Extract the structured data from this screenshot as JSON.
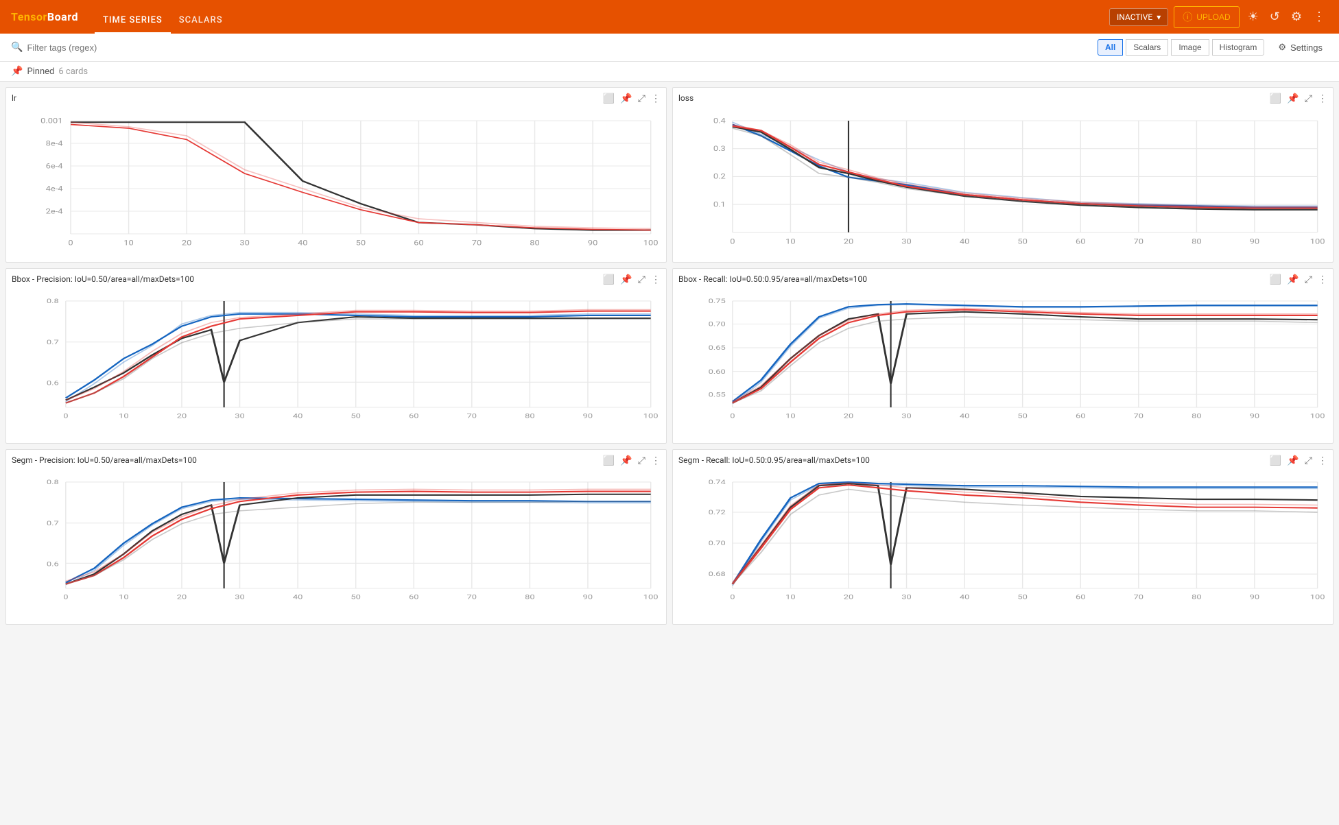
{
  "header": {
    "logo_tensor": "Tensor",
    "logo_board": "Board",
    "nav_items": [
      "TIME SERIES",
      "SCALARS"
    ],
    "active_nav": "TIME SERIES",
    "inactive_label": "INACTIVE",
    "upload_label": "UPLOAD",
    "status_color": "#FFB300"
  },
  "search": {
    "placeholder": "Filter tags (regex)",
    "filter_buttons": [
      "All",
      "Scalars",
      "Image",
      "Histogram"
    ],
    "active_filter": "All",
    "settings_label": "Settings"
  },
  "pinned": {
    "label": "Pinned",
    "count": "6 cards"
  },
  "charts": [
    {
      "id": "lr",
      "title": "lr",
      "y_labels": [
        "0.001",
        "8e-4",
        "6e-4",
        "4e-4",
        "2e-4"
      ],
      "x_labels": [
        "0",
        "10",
        "20",
        "30",
        "40",
        "50",
        "60",
        "70",
        "80",
        "90",
        "100"
      ]
    },
    {
      "id": "loss",
      "title": "loss",
      "y_labels": [
        "0.4",
        "0.3",
        "0.2",
        "0.1"
      ],
      "x_labels": [
        "0",
        "10",
        "20",
        "30",
        "40",
        "50",
        "60",
        "70",
        "80",
        "90",
        "100"
      ]
    },
    {
      "id": "bbox_precision",
      "title": "Bbox - Precision: IoU=0.50/area=all/maxDets=100",
      "y_labels": [
        "0.8",
        "0.7",
        "0.6"
      ],
      "x_labels": [
        "0",
        "10",
        "20",
        "30",
        "40",
        "50",
        "60",
        "70",
        "80",
        "90",
        "100"
      ]
    },
    {
      "id": "bbox_recall",
      "title": "Bbox - Recall: IoU=0.50:0.95/area=all/maxDets=100",
      "y_labels": [
        "0.75",
        "0.7",
        "0.65",
        "0.6",
        "0.55"
      ],
      "x_labels": [
        "0",
        "10",
        "20",
        "30",
        "40",
        "50",
        "60",
        "70",
        "80",
        "90",
        "100"
      ]
    },
    {
      "id": "segm_precision",
      "title": "Segm - Precision: IoU=0.50/area=all/maxDets=100",
      "y_labels": [
        "0.8",
        "0.7",
        "0.6"
      ],
      "x_labels": [
        "0",
        "10",
        "20",
        "30",
        "40",
        "50",
        "60",
        "70",
        "80",
        "90",
        "100"
      ]
    },
    {
      "id": "segm_recall",
      "title": "Segm - Recall: IoU=0.50:0.95/area=all/maxDets=100",
      "y_labels": [
        "0.74",
        "0.72",
        "0.7",
        "0.68"
      ],
      "x_labels": [
        "0",
        "10",
        "20",
        "30",
        "40",
        "50",
        "60",
        "70",
        "80",
        "90",
        "100"
      ]
    }
  ],
  "icons": {
    "pin": "📌",
    "expand": "⤢",
    "more": "⋮",
    "image": "🖼",
    "search": "🔍",
    "settings_gear": "⚙",
    "sun": "☀",
    "refresh": "↺",
    "upload_icon": "ⓘ",
    "chevron_down": "▾"
  }
}
